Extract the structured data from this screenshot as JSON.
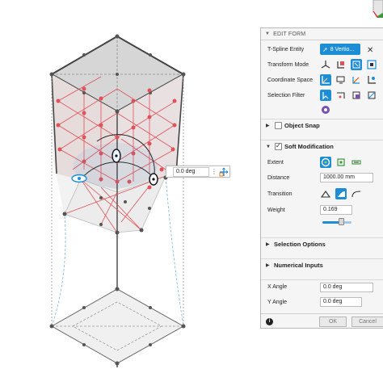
{
  "angle_input": {
    "value": "0.0 deg"
  },
  "panel": {
    "title": "EDIT FORM",
    "tspline_entity": {
      "label": "T-Spline Entity",
      "value": "8 Vertio..."
    },
    "transform_mode": {
      "label": "Transform Mode"
    },
    "coordinate_space": {
      "label": "Coordinate Space"
    },
    "selection_filter": {
      "label": "Selection Filter"
    },
    "object_snap": {
      "label": "Object Snap",
      "checked": false
    },
    "soft_modification": {
      "label": "Soft Modification",
      "checked": true
    },
    "extent": {
      "label": "Extent"
    },
    "distance": {
      "label": "Distance",
      "value": "1000.00 mm"
    },
    "transition": {
      "label": "Transition"
    },
    "weight": {
      "label": "Weight",
      "value": "0.169",
      "level": 0.169
    },
    "selection_options": {
      "label": "Selection Options"
    },
    "numerical_inputs": {
      "label": "Numerical Inputs"
    },
    "x_angle": {
      "label": "X Angle",
      "value": "0.0 deg"
    },
    "y_angle": {
      "label": "Y Angle",
      "value": "0.0 deg"
    },
    "ok_label": "OK",
    "cancel_label": "Cancel"
  },
  "colors": {
    "accent": "#1d8ed6",
    "control_point_red": "#e0525a",
    "control_point_gray": "#555555",
    "surface_gray": "#cfcfcf"
  },
  "icons": [
    "viewcube",
    "cursor-icon",
    "menu-dots-icon",
    "move-icon",
    "info-icon"
  ]
}
